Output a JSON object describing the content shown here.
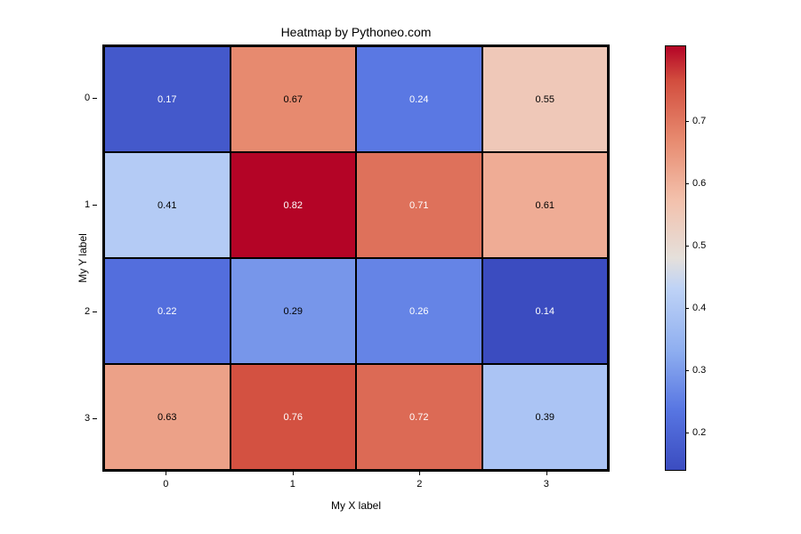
{
  "chart_data": {
    "type": "heatmap",
    "title": "Heatmap by Pythoneo.com",
    "xlabel": "My X label",
    "ylabel": "My Y label",
    "x_ticks": [
      "0",
      "1",
      "2",
      "3"
    ],
    "y_ticks": [
      "0",
      "1",
      "2",
      "3"
    ],
    "values": [
      [
        0.17,
        0.67,
        0.24,
        0.55
      ],
      [
        0.41,
        0.82,
        0.71,
        0.61
      ],
      [
        0.22,
        0.29,
        0.26,
        0.14
      ],
      [
        0.63,
        0.76,
        0.72,
        0.39
      ]
    ],
    "colorbar_ticks": [
      "0.2",
      "0.3",
      "0.4",
      "0.5",
      "0.6",
      "0.7"
    ],
    "vmin": 0.14,
    "vmax": 0.82
  }
}
